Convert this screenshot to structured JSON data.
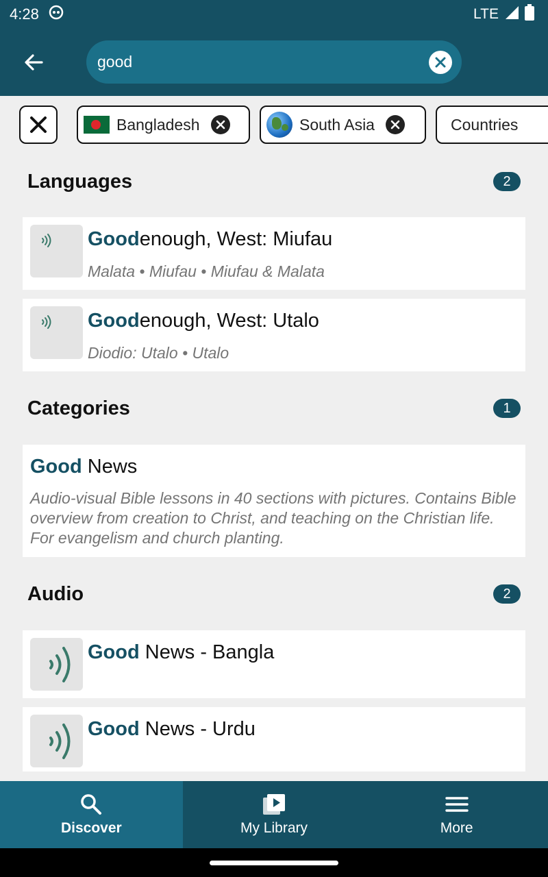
{
  "status_bar": {
    "time": "4:28",
    "network": "LTE"
  },
  "search": {
    "value": "good"
  },
  "chips": {
    "bangladesh": "Bangladesh",
    "south_asia": "South Asia",
    "countries": "Countries"
  },
  "languages": {
    "title": "Languages",
    "count": "2",
    "items": [
      {
        "hl": "Good",
        "rest": "enough, West: Miufau",
        "sub": "Malata • Miufau • Miufau & Malata"
      },
      {
        "hl": "Good",
        "rest": "enough, West: Utalo",
        "sub": "Diodio: Utalo • Utalo"
      }
    ]
  },
  "categories": {
    "title": "Categories",
    "count": "1",
    "items": [
      {
        "hl": "Good",
        "rest": " News",
        "desc": "Audio-visual Bible lessons in 40 sections with pictures. Contains Bible overview from creation to Christ, and teaching on the Christian life. For evangelism and church planting."
      }
    ]
  },
  "audio": {
    "title": "Audio",
    "count": "2",
    "items": [
      {
        "hl": "Good",
        "rest": " News - Bangla"
      },
      {
        "hl": "Good",
        "rest": " News - Urdu"
      }
    ]
  },
  "nav": {
    "discover": "Discover",
    "library": "My Library",
    "more": "More"
  },
  "colors": {
    "primary": "#155063",
    "active_tab": "#1b6a84",
    "search_bg": "#1b7089"
  }
}
